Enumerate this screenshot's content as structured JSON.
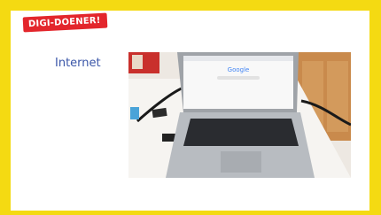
{
  "badge": {
    "label": "DIGI-DOENER!"
  },
  "slide": {
    "heading": "Internet"
  },
  "photo": {
    "screen_logo": "Google",
    "colors": {
      "frame": "#f4da12",
      "badge": "#e3262c",
      "heading": "#3a56a8"
    }
  }
}
